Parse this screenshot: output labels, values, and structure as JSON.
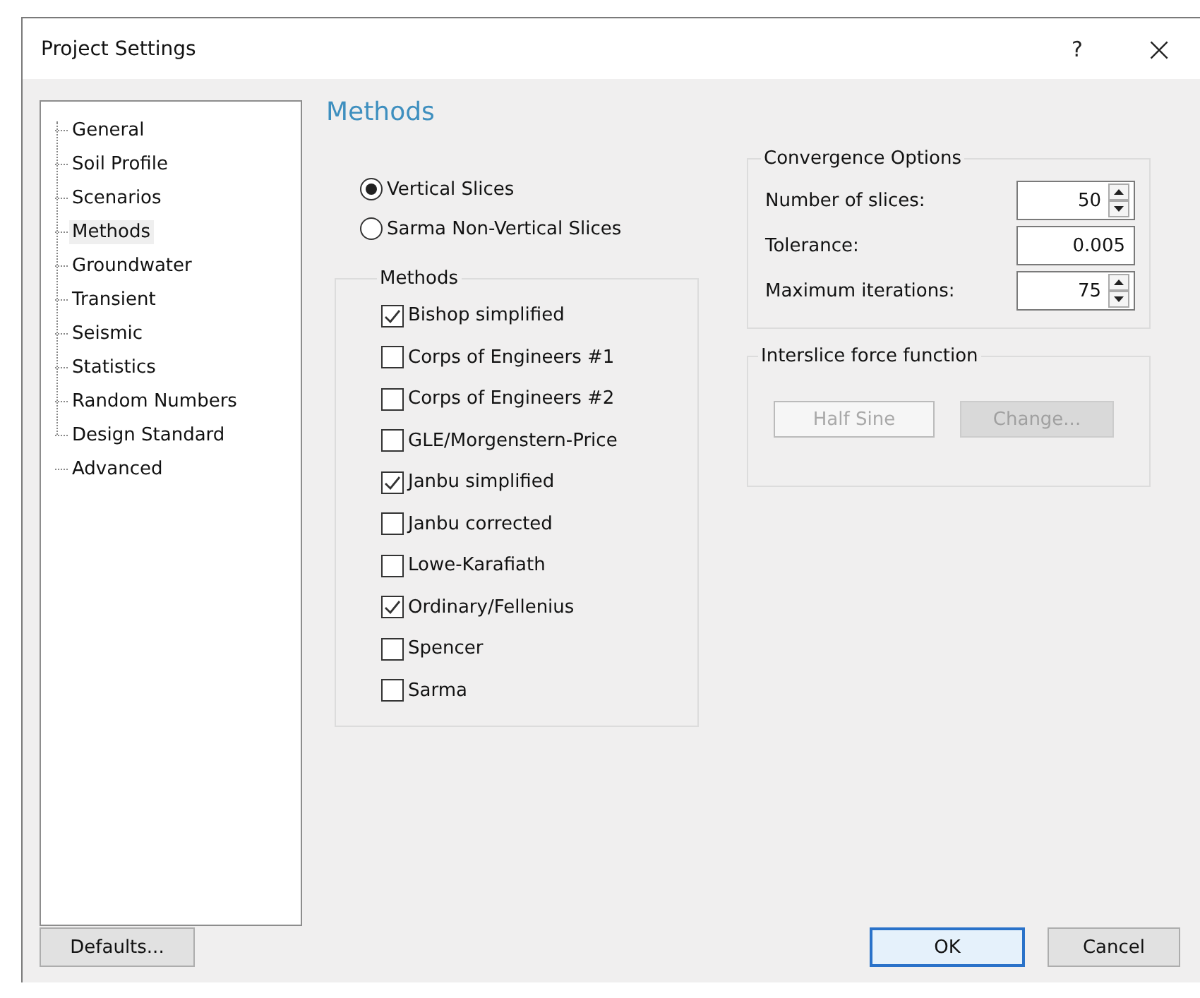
{
  "window": {
    "title": "Project Settings",
    "help_glyph": "?",
    "close_glyph": "×"
  },
  "sidebar": {
    "items": [
      {
        "label": "General",
        "selected": false
      },
      {
        "label": "Soil Profile",
        "selected": false
      },
      {
        "label": "Scenarios",
        "selected": false
      },
      {
        "label": "Methods",
        "selected": true
      },
      {
        "label": "Groundwater",
        "selected": false
      },
      {
        "label": "Transient",
        "selected": false
      },
      {
        "label": "Seismic",
        "selected": false
      },
      {
        "label": "Statistics",
        "selected": false
      },
      {
        "label": "Random Numbers",
        "selected": false
      },
      {
        "label": "Design Standard",
        "selected": false
      },
      {
        "label": "Advanced",
        "selected": false
      }
    ]
  },
  "page_heading": "Methods",
  "slice_options": [
    {
      "label": "Vertical Slices",
      "selected": true
    },
    {
      "label": "Sarma Non-Vertical Slices",
      "selected": false
    }
  ],
  "methods_group": {
    "title": "Methods",
    "items": [
      {
        "label": "Bishop simplified",
        "checked": true
      },
      {
        "label": "Corps of Engineers #1",
        "checked": false
      },
      {
        "label": "Corps of Engineers #2",
        "checked": false
      },
      {
        "label": "GLE/Morgenstern-Price",
        "checked": false
      },
      {
        "label": "Janbu simplified",
        "checked": true
      },
      {
        "label": "Janbu corrected",
        "checked": false
      },
      {
        "label": "Lowe-Karafiath",
        "checked": false
      },
      {
        "label": "Ordinary/Fellenius",
        "checked": true
      },
      {
        "label": "Spencer",
        "checked": false
      },
      {
        "label": "Sarma",
        "checked": false
      }
    ]
  },
  "convergence_options": {
    "title": "Convergence Options",
    "fields": [
      {
        "kind": "spinner",
        "label": "Number of slices:",
        "value": "50"
      },
      {
        "kind": "text",
        "label": "Tolerance:",
        "value": "0.005"
      },
      {
        "kind": "spinner",
        "label": "Maximum iterations:",
        "value": "75"
      }
    ]
  },
  "interslice_force_function": {
    "title": "Interslice force function",
    "value": "Half Sine",
    "button": "Change...",
    "disabled": true
  },
  "buttons": {
    "defaults": "Defaults...",
    "ok": "OK",
    "cancel": "Cancel"
  }
}
